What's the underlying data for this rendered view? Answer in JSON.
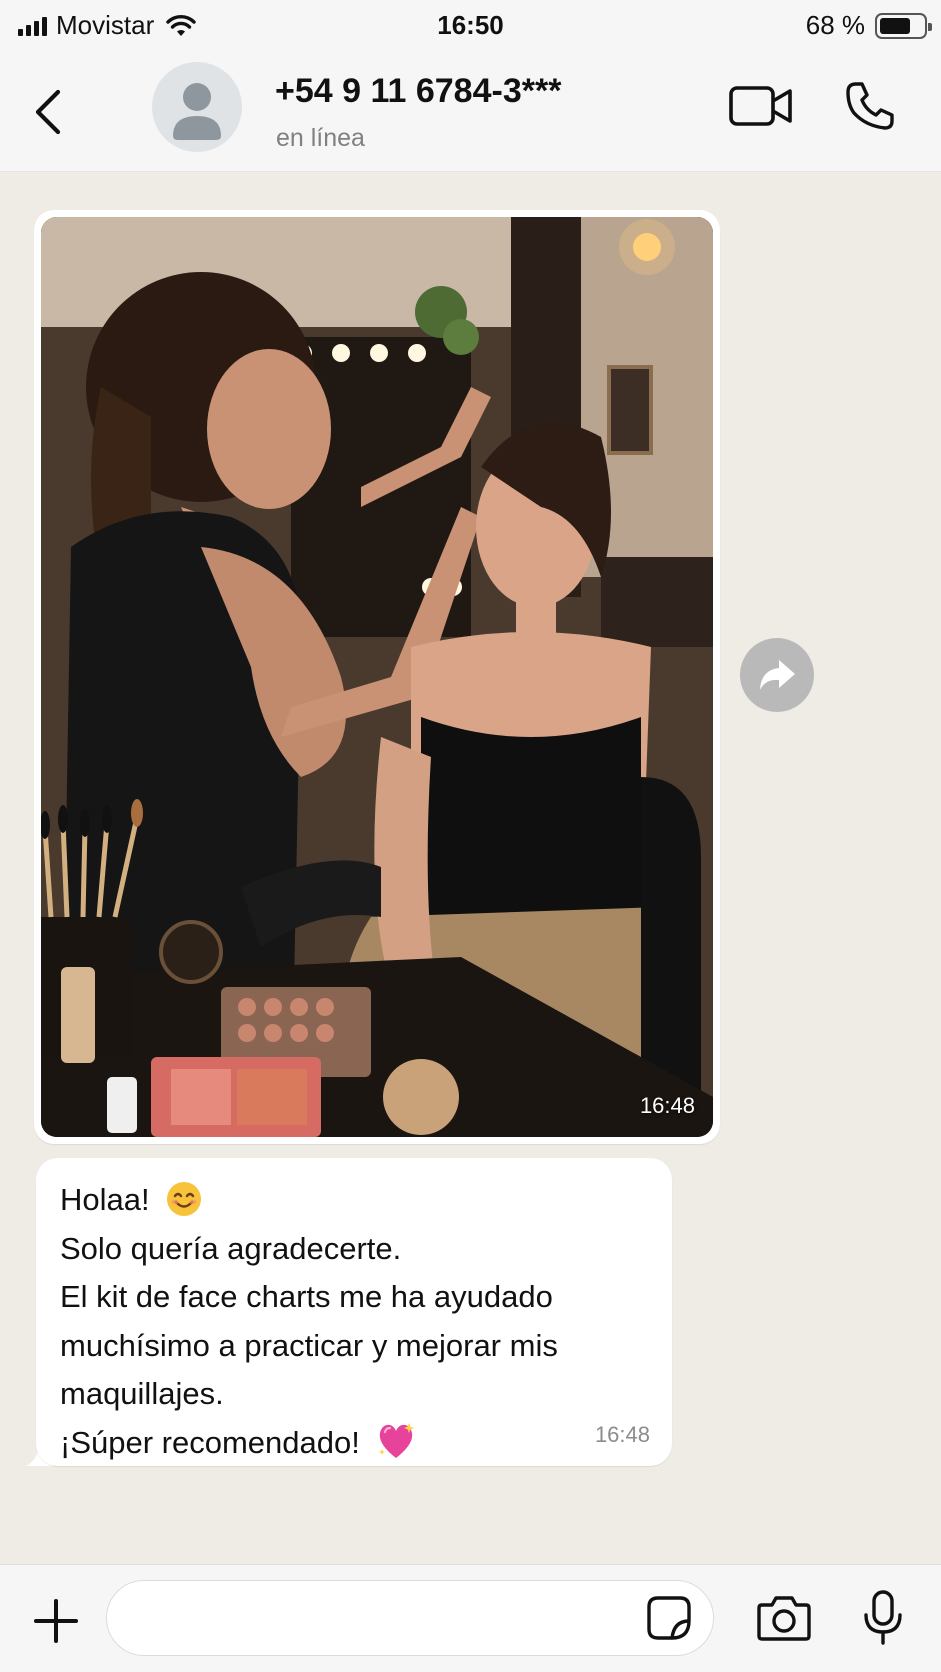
{
  "status_bar": {
    "carrier": "Movistar",
    "time": "16:50",
    "battery_percent": "68 %",
    "battery_level": 0.68,
    "signal_icon": "signal-bars-icon",
    "wifi_icon": "wifi-icon",
    "battery_icon": "battery-icon"
  },
  "header": {
    "contact_name": "+54 9 11 6784-3***",
    "contact_status": "en línea",
    "back_icon": "chevron-left-icon",
    "avatar_icon": "person-placeholder-icon",
    "video_call_icon": "video-camera-icon",
    "voice_call_icon": "phone-icon"
  },
  "messages": [
    {
      "type": "image",
      "image_description_icon": "photo-makeup-artist",
      "time": "16:48"
    },
    {
      "type": "text",
      "lines": [
        "Holaa!",
        "Solo quería agradecerte.",
        "El kit de face charts me ha ayudado",
        "muchísimo a practicar y mejorar mis",
        "maquillajes.",
        "¡Súper recomendado!"
      ],
      "emojis": [
        "smiling-face-emoji",
        "sparkling-heart-emoji"
      ],
      "time": "16:48"
    }
  ],
  "forward_icon": "forward-arrow-icon",
  "input_bar": {
    "input_value": "",
    "plus_icon": "plus-icon",
    "sticker_icon": "sticker-icon",
    "camera_icon": "camera-icon",
    "mic_icon": "microphone-icon"
  },
  "colors": {
    "chat_background": "#efebe5",
    "bar_background": "#f6f6f6",
    "bubble": "#ffffff",
    "muted_text": "#808080",
    "emoji_heart": "#e8439a",
    "emoji_smile": "#f6c33b"
  }
}
